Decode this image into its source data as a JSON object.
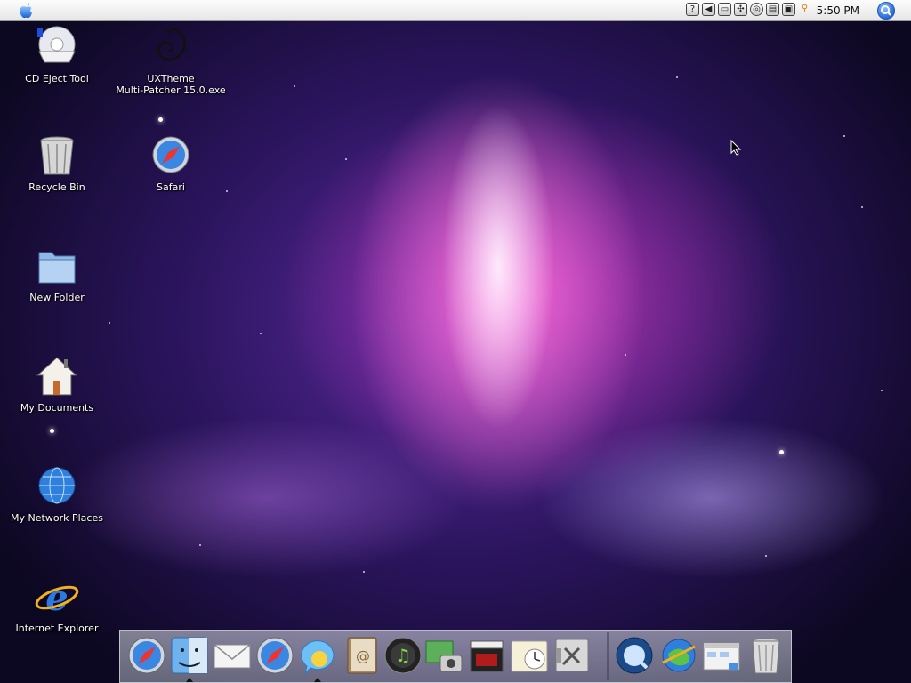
{
  "menubar": {
    "clock": "5:50 PM",
    "tray_icons": [
      "help-icon",
      "speaker-icon",
      "display-icon",
      "network-icon",
      "cd-icon",
      "monitor-icon",
      "window-icon",
      "search-glass-icon"
    ]
  },
  "desktop_icons": [
    {
      "id": "cd-eject-tool",
      "label": "CD Eject Tool",
      "icon": "cd-eject-icon"
    },
    {
      "id": "uxtheme",
      "label": "UXTheme\nMulti-Patcher 15.0.exe",
      "icon": "dragon-icon"
    },
    {
      "id": "recycle-bin",
      "label": "Recycle Bin",
      "icon": "trash-icon"
    },
    {
      "id": "safari",
      "label": "Safari",
      "icon": "safari-compass-icon"
    },
    {
      "id": "new-folder",
      "label": "New Folder",
      "icon": "folder-icon"
    },
    {
      "id": "my-documents",
      "label": "My Documents",
      "icon": "home-icon"
    },
    {
      "id": "my-network-places",
      "label": "My Network Places",
      "icon": "network-globe-icon"
    },
    {
      "id": "internet-explorer",
      "label": "Internet Explorer",
      "icon": "ie-icon"
    }
  ],
  "dock": {
    "items": [
      "safari-icon",
      "finder-icon",
      "mail-icon",
      "safari-icon",
      "ichat-icon",
      "address-book-icon",
      "itunes-icon",
      "iphoto-icon",
      "imovie-icon",
      "ical-icon",
      "system-preferences-icon",
      "quicktime-icon",
      "internet-connect-icon",
      "folder-window-icon",
      "trash-can-icon"
    ]
  },
  "colors": {
    "menubar_top": "#fdfdfd",
    "menubar_bottom": "#e6e6e6",
    "wallpaper_pink": "#ff6fd8",
    "wallpaper_purple": "#3a1a7a"
  }
}
